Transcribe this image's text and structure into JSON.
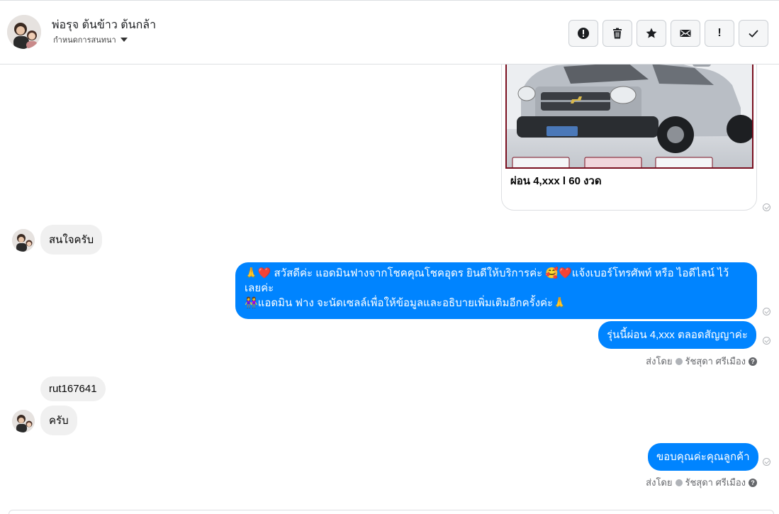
{
  "header": {
    "contact_name": "พ่อรุจ ต้นข้าว ต้นกล้า",
    "assign_label": "กำหนดการสนทนา"
  },
  "actions": [
    {
      "icon": "alert-circle-icon"
    },
    {
      "icon": "trash-icon"
    },
    {
      "icon": "star-icon"
    },
    {
      "icon": "mail-icon"
    },
    {
      "icon": "exclamation-icon",
      "glyph": "!"
    },
    {
      "icon": "check-icon"
    }
  ],
  "messages": {
    "card_caption": "ผ่อน 4,xxx l 60 งวด",
    "in_1": "สนใจครับ",
    "out_1_line1": "🙏❤️ สวัสดีค่ะ แอดมินฟางจากโชคคุณโชคอุดร ยินดีให้บริการค่ะ 🥰❤️แจ้งเบอร์โทรศัพท์ หรือ ไอดีไลน์ ไว้",
    "out_1_line2": "เลยค่ะ",
    "out_1_line3": "👭แอดมิน ฟาง จะนัดเซลล์เพื่อให้ข้อมูลและอธิบายเพิ่มเติมอีกครั้งค่ะ🙏",
    "out_2": "รุ่นนี้ผ่อน 4,xxx ตลอดสัญญาค่ะ",
    "sent_by_1_prefix": "ส่งโดย",
    "sent_by_1_name": "รัชสุดา ศรีเมือง",
    "in_2": "rut167641",
    "in_3": "ครับ",
    "out_3": "ขอบคุณค่ะคุณลูกค้า",
    "sent_by_2_prefix": "ส่งโดย",
    "sent_by_2_name": "รัชสุดา ศรีเมือง"
  },
  "colors": {
    "outgoing_bubble": "#0084ff",
    "incoming_bubble": "#f0f0f0",
    "card_frame": "#7a1020"
  }
}
